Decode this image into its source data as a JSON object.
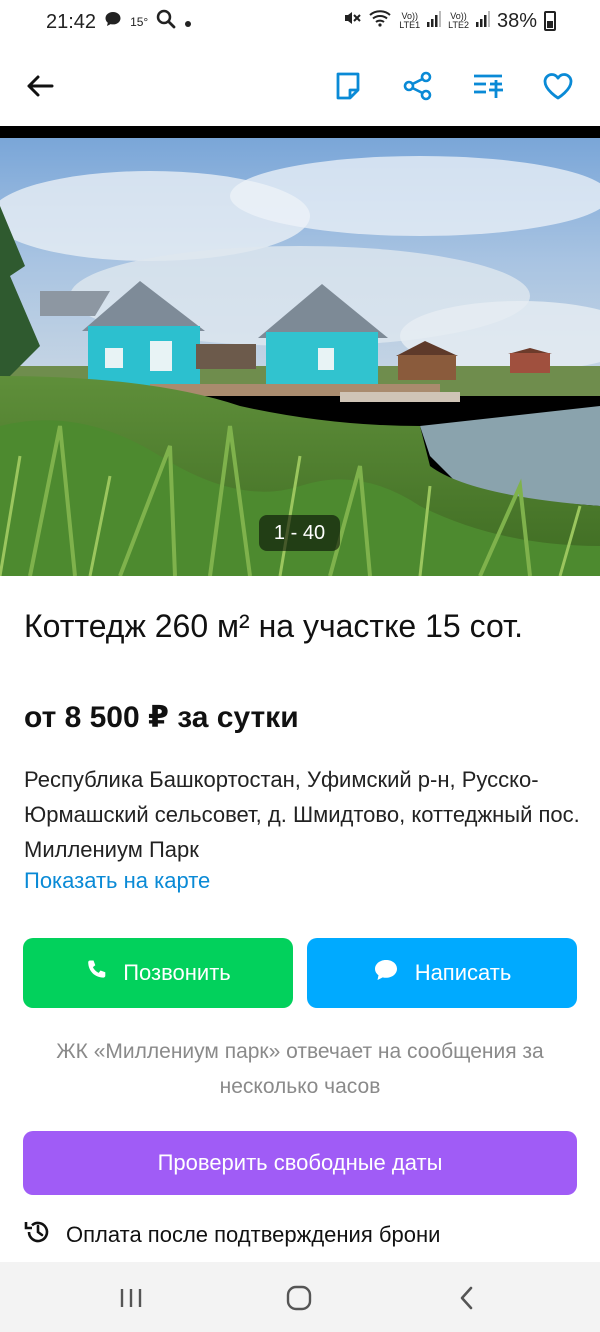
{
  "status_bar": {
    "time": "21:42",
    "temperature": "15°",
    "net1_top": "Vo))",
    "net1_bottom": "LTE1",
    "net2_top": "Vo))",
    "net2_bottom": "LTE2",
    "battery": "38%"
  },
  "app_bar": {
    "icons": [
      "back-arrow-icon",
      "note-icon",
      "share-icon",
      "compare-icon",
      "favorite-heart-icon"
    ]
  },
  "gallery": {
    "counter": "1 - 40"
  },
  "listing": {
    "title": "Коттедж 260 м² на участке 15 сот.",
    "price": "от 8 500 ₽ за сутки",
    "address": "Республика Башкортостан, Уфимский р-н, Русско-Юрмашский сельсовет, д. Шмидтово, коттеджный пос. Миллениум Парк",
    "map_link": "Показать на карте"
  },
  "actions": {
    "call_label": "Позвонить",
    "write_label": "Написать",
    "response_note": "ЖК «Миллениум парк» отвечает на сообщения за несколько часов",
    "check_dates_label": "Проверить свободные даты",
    "payment_note": "Оплата после подтверждения брони"
  },
  "colors": {
    "accent_blue": "#0a8ad6",
    "call_green": "#02d15c",
    "write_blue": "#00aaff",
    "dates_purple": "#a05cf6"
  }
}
